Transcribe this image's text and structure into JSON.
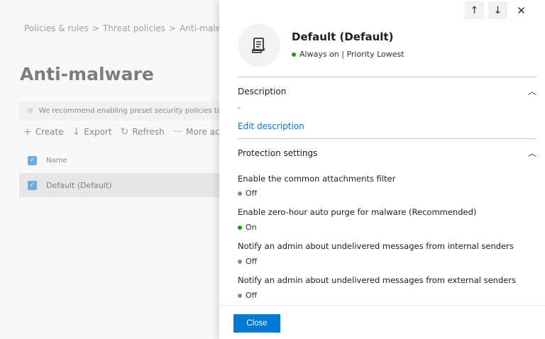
{
  "background": {
    "breadcrumb": [
      "Policies & rules",
      "Threat policies",
      "Anti-malware"
    ],
    "page_title": "Anti-malware",
    "banner_text": "We recommend enabling preset security policies to stay u",
    "commands": {
      "create": "Create",
      "export": "Export",
      "refresh": "Refresh",
      "more": "More actio"
    },
    "list": {
      "header_name": "Name",
      "rows": [
        "Default (Default)"
      ]
    }
  },
  "panel": {
    "title": "Default (Default)",
    "status": "Always on | Priority Lowest",
    "description": {
      "heading": "Description",
      "value": "-",
      "edit_link": "Edit description"
    },
    "protection": {
      "heading": "Protection settings",
      "settings": [
        {
          "label": "Enable the common attachments filter",
          "value": "Off"
        },
        {
          "label": "Enable zero-hour auto purge for malware (Recommended)",
          "value": "On"
        },
        {
          "label": "Notify an admin about undelivered messages from internal senders",
          "value": "Off"
        },
        {
          "label": "Notify an admin about undelivered messages from external senders",
          "value": "Off"
        }
      ]
    },
    "close_label": "Close"
  },
  "colors": {
    "accent": "#0078d4",
    "on": "#13a10e",
    "off": "#8a8886"
  }
}
